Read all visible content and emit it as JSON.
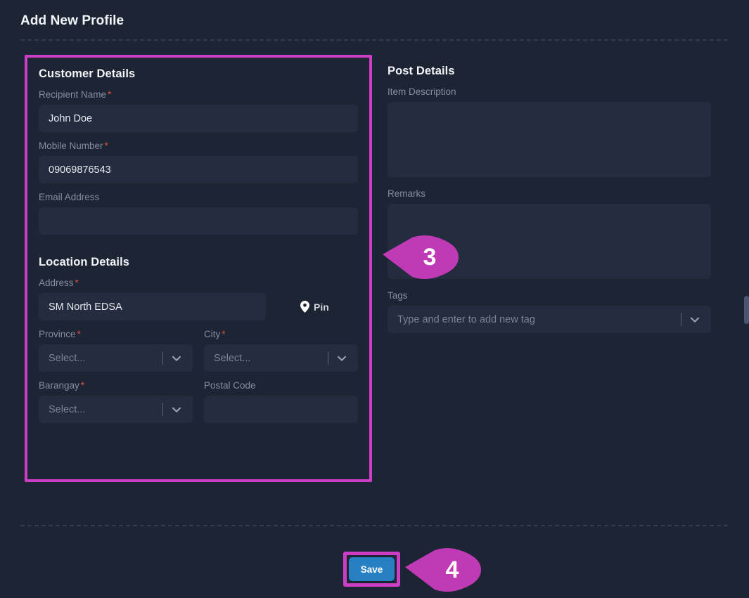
{
  "page": {
    "title": "Add New Profile"
  },
  "customer_details": {
    "heading": "Customer Details",
    "recipient_name": {
      "label": "Recipient Name",
      "required": true,
      "value": "John Doe"
    },
    "mobile_number": {
      "label": "Mobile Number",
      "required": true,
      "value": "09069876543"
    },
    "email_address": {
      "label": "Email Address",
      "required": false,
      "value": ""
    }
  },
  "location_details": {
    "heading": "Location Details",
    "address": {
      "label": "Address",
      "required": true,
      "value": "SM North EDSA"
    },
    "pin_button": {
      "label": "Pin",
      "icon": "map-pin-icon"
    },
    "province": {
      "label": "Province",
      "required": true,
      "value": "Select...",
      "icon": "chevron-down-icon"
    },
    "city": {
      "label": "City",
      "required": true,
      "value": "Select...",
      "icon": "chevron-down-icon"
    },
    "barangay": {
      "label": "Barangay",
      "required": true,
      "value": "Select...",
      "icon": "chevron-down-icon"
    },
    "postal_code": {
      "label": "Postal Code",
      "required": false,
      "value": ""
    }
  },
  "post_details": {
    "heading": "Post Details",
    "item_description": {
      "label": "Item Description",
      "value": ""
    },
    "remarks": {
      "label": "Remarks",
      "value": ""
    },
    "tags": {
      "label": "Tags",
      "placeholder": "Type and enter to add new tag",
      "value": "",
      "icon": "chevron-down-icon"
    }
  },
  "footer": {
    "save_label": "Save"
  },
  "callouts": [
    {
      "number": "3"
    },
    {
      "number": "4"
    }
  ],
  "colors": {
    "page_background": "#1d2433",
    "field_background": "#242d3f",
    "highlight_magenta": "#cc3ec4",
    "save_blue": "#2680c2",
    "label_gray": "#858e9f",
    "required_red": "#e15241"
  }
}
